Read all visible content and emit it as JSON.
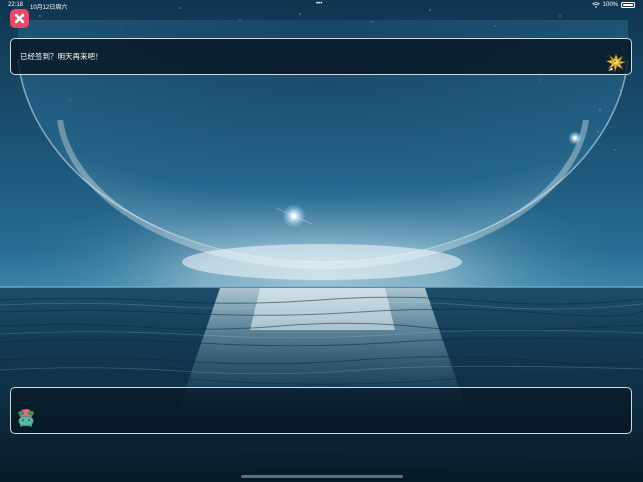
{
  "status_bar": {
    "time": "22:18",
    "date": "10月12日周六",
    "dots": "•••",
    "battery_percent": "100%"
  },
  "close_button": {
    "icon": "close-icon",
    "color": "#e8496a"
  },
  "top_bubble": {
    "message": "已经签到？明天再来吧！",
    "sprite": "pokemon-sprite-yellow"
  },
  "bottom_bubble": {
    "sprite": "pokemon-sprite-plant"
  },
  "colors": {
    "sky_top": "#0f3550",
    "horizon_glow": "#e8f6fa",
    "sea_dark": "#0a2233"
  }
}
